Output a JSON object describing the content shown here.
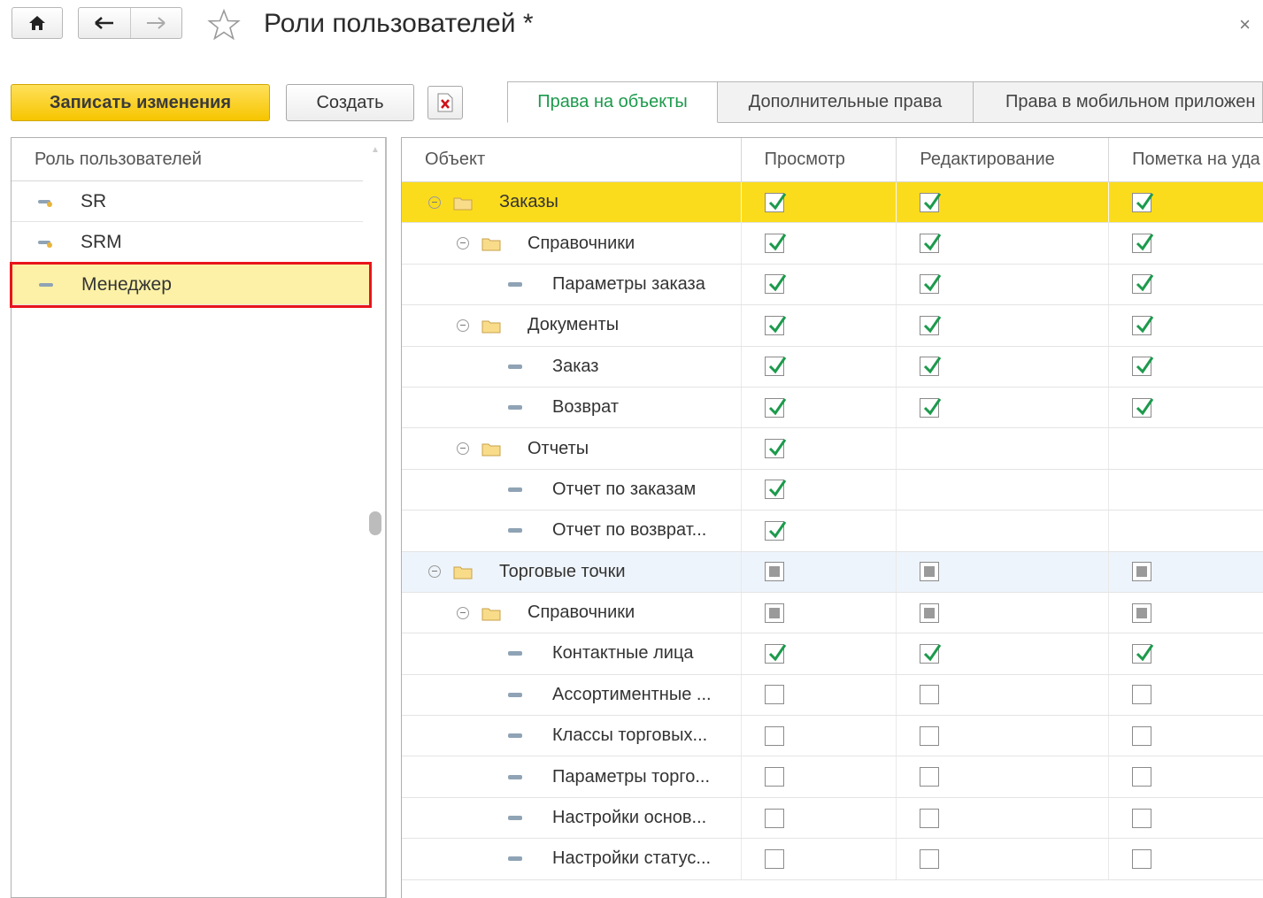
{
  "window": {
    "title": "Роли пользователей *",
    "close_label": "×"
  },
  "toolbar": {
    "save_label": "Записать изменения",
    "create_label": "Создать",
    "delete_icon": "delete-icon"
  },
  "tabs": [
    {
      "label": "Права на объекты",
      "active": true
    },
    {
      "label": "Дополнительные права",
      "active": false
    },
    {
      "label": "Права в мобильном приложен",
      "active": false
    }
  ],
  "roles": {
    "header": "Роль пользователей",
    "items": [
      {
        "label": "SR",
        "selected": false
      },
      {
        "label": "SRM",
        "selected": false
      },
      {
        "label": "Менеджер",
        "selected": true
      }
    ]
  },
  "table": {
    "columns": [
      "Объект",
      "Просмотр",
      "Редактирование",
      "Пометка на уда"
    ],
    "rows": [
      {
        "name": "Заказы",
        "level": 0,
        "type": "folder",
        "view": "checked",
        "edit": "checked",
        "del": "checked",
        "state": "current"
      },
      {
        "name": "Справочники",
        "level": 1,
        "type": "folder",
        "view": "checked",
        "edit": "checked",
        "del": "checked"
      },
      {
        "name": "Параметры заказа",
        "level": 2,
        "type": "item",
        "view": "checked",
        "edit": "checked",
        "del": "checked"
      },
      {
        "name": "Документы",
        "level": 1,
        "type": "folder",
        "view": "checked",
        "edit": "checked",
        "del": "checked"
      },
      {
        "name": "Заказ",
        "level": 2,
        "type": "item",
        "view": "checked",
        "edit": "checked",
        "del": "checked"
      },
      {
        "name": "Возврат",
        "level": 2,
        "type": "item",
        "view": "checked",
        "edit": "checked",
        "del": "checked"
      },
      {
        "name": "Отчеты",
        "level": 1,
        "type": "folder",
        "view": "checked",
        "edit": "none",
        "del": "none"
      },
      {
        "name": "Отчет по заказам",
        "level": 2,
        "type": "item",
        "view": "checked",
        "edit": "none",
        "del": "none"
      },
      {
        "name": "Отчет по возврат...",
        "level": 2,
        "type": "item",
        "view": "checked",
        "edit": "none",
        "del": "none"
      },
      {
        "name": "Торговые точки",
        "level": 0,
        "type": "folder",
        "view": "partial",
        "edit": "partial",
        "del": "partial",
        "state": "hover"
      },
      {
        "name": "Справочники",
        "level": 1,
        "type": "folder",
        "view": "partial",
        "edit": "partial",
        "del": "partial"
      },
      {
        "name": "Контактные лица",
        "level": 2,
        "type": "item",
        "view": "checked",
        "edit": "checked",
        "del": "checked"
      },
      {
        "name": "Ассортиментные ...",
        "level": 2,
        "type": "item",
        "view": "unchecked",
        "edit": "unchecked",
        "del": "unchecked"
      },
      {
        "name": "Классы торговых...",
        "level": 2,
        "type": "item",
        "view": "unchecked",
        "edit": "unchecked",
        "del": "unchecked"
      },
      {
        "name": "Параметры торго...",
        "level": 2,
        "type": "item",
        "view": "unchecked",
        "edit": "unchecked",
        "del": "unchecked"
      },
      {
        "name": "Настройки основ...",
        "level": 2,
        "type": "item",
        "view": "unchecked",
        "edit": "unchecked",
        "del": "unchecked"
      },
      {
        "name": "Настройки статус...",
        "level": 2,
        "type": "item",
        "view": "unchecked",
        "edit": "unchecked",
        "del": "unchecked"
      }
    ]
  },
  "colors": {
    "accent_yellow": "#f6c500",
    "highlight_row": "#fbdc1c",
    "check_green": "#1c9a4c",
    "selection_border": "#e8141c"
  }
}
